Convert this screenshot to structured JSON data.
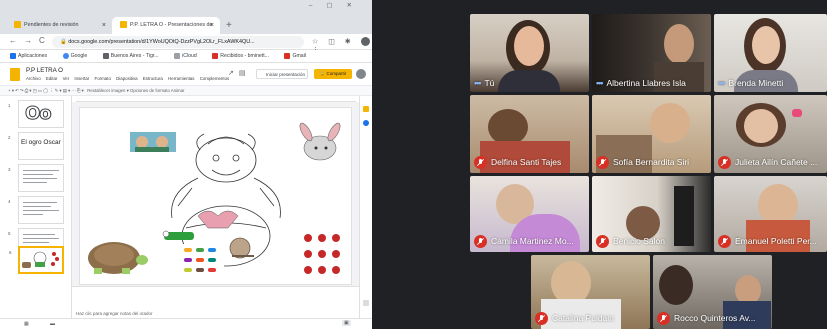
{
  "browser": {
    "tabs": [
      {
        "label": "Pendientes de revisión"
      },
      {
        "label": "P.P. LETRA O - Presentaciones de"
      }
    ],
    "url": "docs.google.com/presentation/d/1YWoUQOtQ-DzzPVgL2OLr_FLxAWK4QU...",
    "bookmarks": [
      "Aplicaciones",
      "Google",
      "Buenos Aires - Tigr...",
      "iCloud",
      "Recibidos - bminett...",
      "Gmail"
    ]
  },
  "slides": {
    "title": "P.P LETRA O",
    "menu": [
      "Archivo",
      "Editar",
      "Ver",
      "Insertar",
      "Formato",
      "Diapositiva",
      "Estructura",
      "Herramientas",
      "Complementos"
    ],
    "present_label": "Iniciar presentación",
    "share_label": "Compartir",
    "toolbar_text": "Restablecer imagen ▾   Opciones de formato   Animar",
    "thumb1_big": "Oo",
    "thumb2_caption": "El ogro Oscar",
    "notes_placeholder": "Haz clic para agregar notas del orador",
    "thumb_numbers": [
      "1",
      "2",
      "3",
      "4",
      "5",
      "6"
    ]
  },
  "meet": {
    "participants": [
      {
        "name": "Tú",
        "muted": false
      },
      {
        "name": "Albertina Llabres Isla",
        "muted": false
      },
      {
        "name": "Brenda Minetti",
        "muted": false
      },
      {
        "name": "Delfina Santi Tajes",
        "muted": true
      },
      {
        "name": "Sofía Bernardita Siri",
        "muted": true
      },
      {
        "name": "Julieta Ailín Cañete ...",
        "muted": true
      },
      {
        "name": "Camila Martinez Mo...",
        "muted": true
      },
      {
        "name": "Benicio Salon",
        "muted": true
      },
      {
        "name": "Emanuel Poletti Per...",
        "muted": true
      },
      {
        "name": "Catalina Puldain",
        "muted": true
      },
      {
        "name": "Rocco Quinteros Av...",
        "muted": true
      }
    ]
  },
  "colors": {
    "muted_red": "#d93025",
    "slides_yellow": "#f4b400",
    "meet_bg": "#202124",
    "speaking_blue": "#8ab4f8"
  }
}
